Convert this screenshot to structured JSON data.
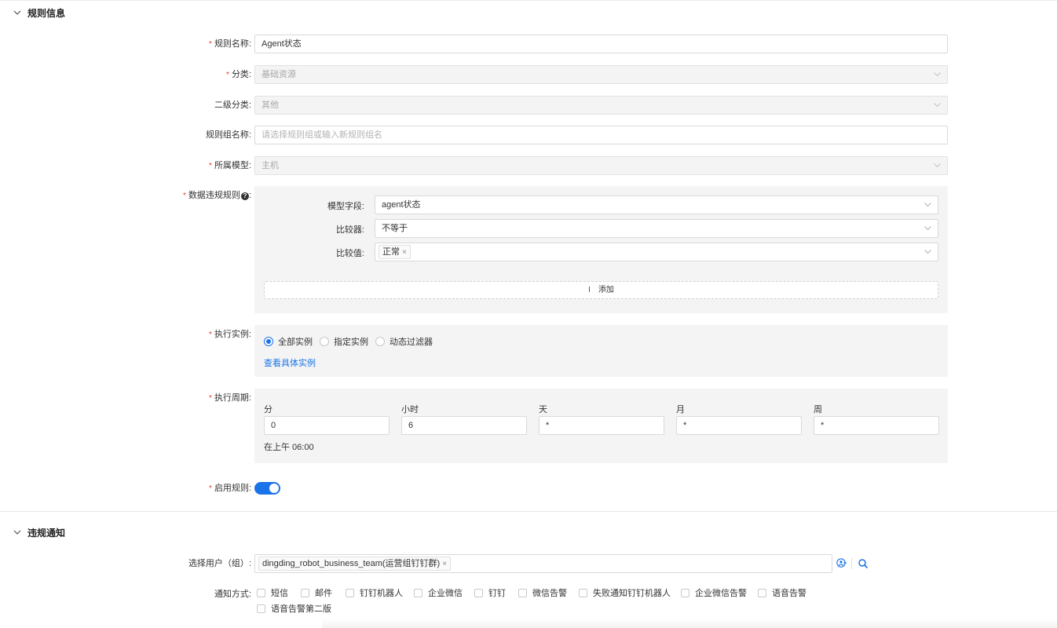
{
  "sections": {
    "rule_info": {
      "title": "规则信息"
    },
    "notify": {
      "title": "违规通知"
    }
  },
  "form": {
    "rule_name": {
      "label": "规则名称",
      "value": "Agent状态"
    },
    "category": {
      "label": "分类",
      "value": "基础资源"
    },
    "sub_category": {
      "label": "二级分类",
      "value": "其他"
    },
    "rule_group": {
      "label": "规则组名称",
      "placeholder": "请选择规则组或输入新规则组名"
    },
    "model": {
      "label": "所属模型",
      "value": "主机"
    },
    "violation": {
      "label": "数据违规规则",
      "help_icon": "question-circle-icon",
      "field_label": "模型字段:",
      "field_value": "agent状态",
      "comparator_label": "比较器:",
      "comparator_value": "不等于",
      "compare_label": "比较值:",
      "compare_tag": "正常",
      "add_label": "添加"
    },
    "exec_instance": {
      "label": "执行实例",
      "options": [
        "全部实例",
        "指定实例",
        "动态过滤器"
      ],
      "selected": "全部实例",
      "link": "查看具体实例"
    },
    "exec_period": {
      "label": "执行周期",
      "fields": [
        {
          "label": "分",
          "value": "0"
        },
        {
          "label": "小时",
          "value": "6"
        },
        {
          "label": "天",
          "value": "*"
        },
        {
          "label": "月",
          "value": "*"
        },
        {
          "label": "周",
          "value": "*"
        }
      ],
      "description": "在上午 06:00"
    },
    "enable": {
      "label": "启用规则",
      "on": true
    }
  },
  "notify": {
    "users_label": "选择用户（组）",
    "user_tag": "dingding_robot_business_team(运营组钉钉群)",
    "methods_label": "通知方式",
    "methods": [
      "短信",
      "邮件",
      "钉钉机器人",
      "企业微信",
      "钉钉",
      "微信告警",
      "失败通知钉钉机器人",
      "企业微信告警",
      "语音告警",
      "语音告警第二版"
    ]
  },
  "colors": {
    "primary": "#1a73e8",
    "required": "#e4393c"
  }
}
